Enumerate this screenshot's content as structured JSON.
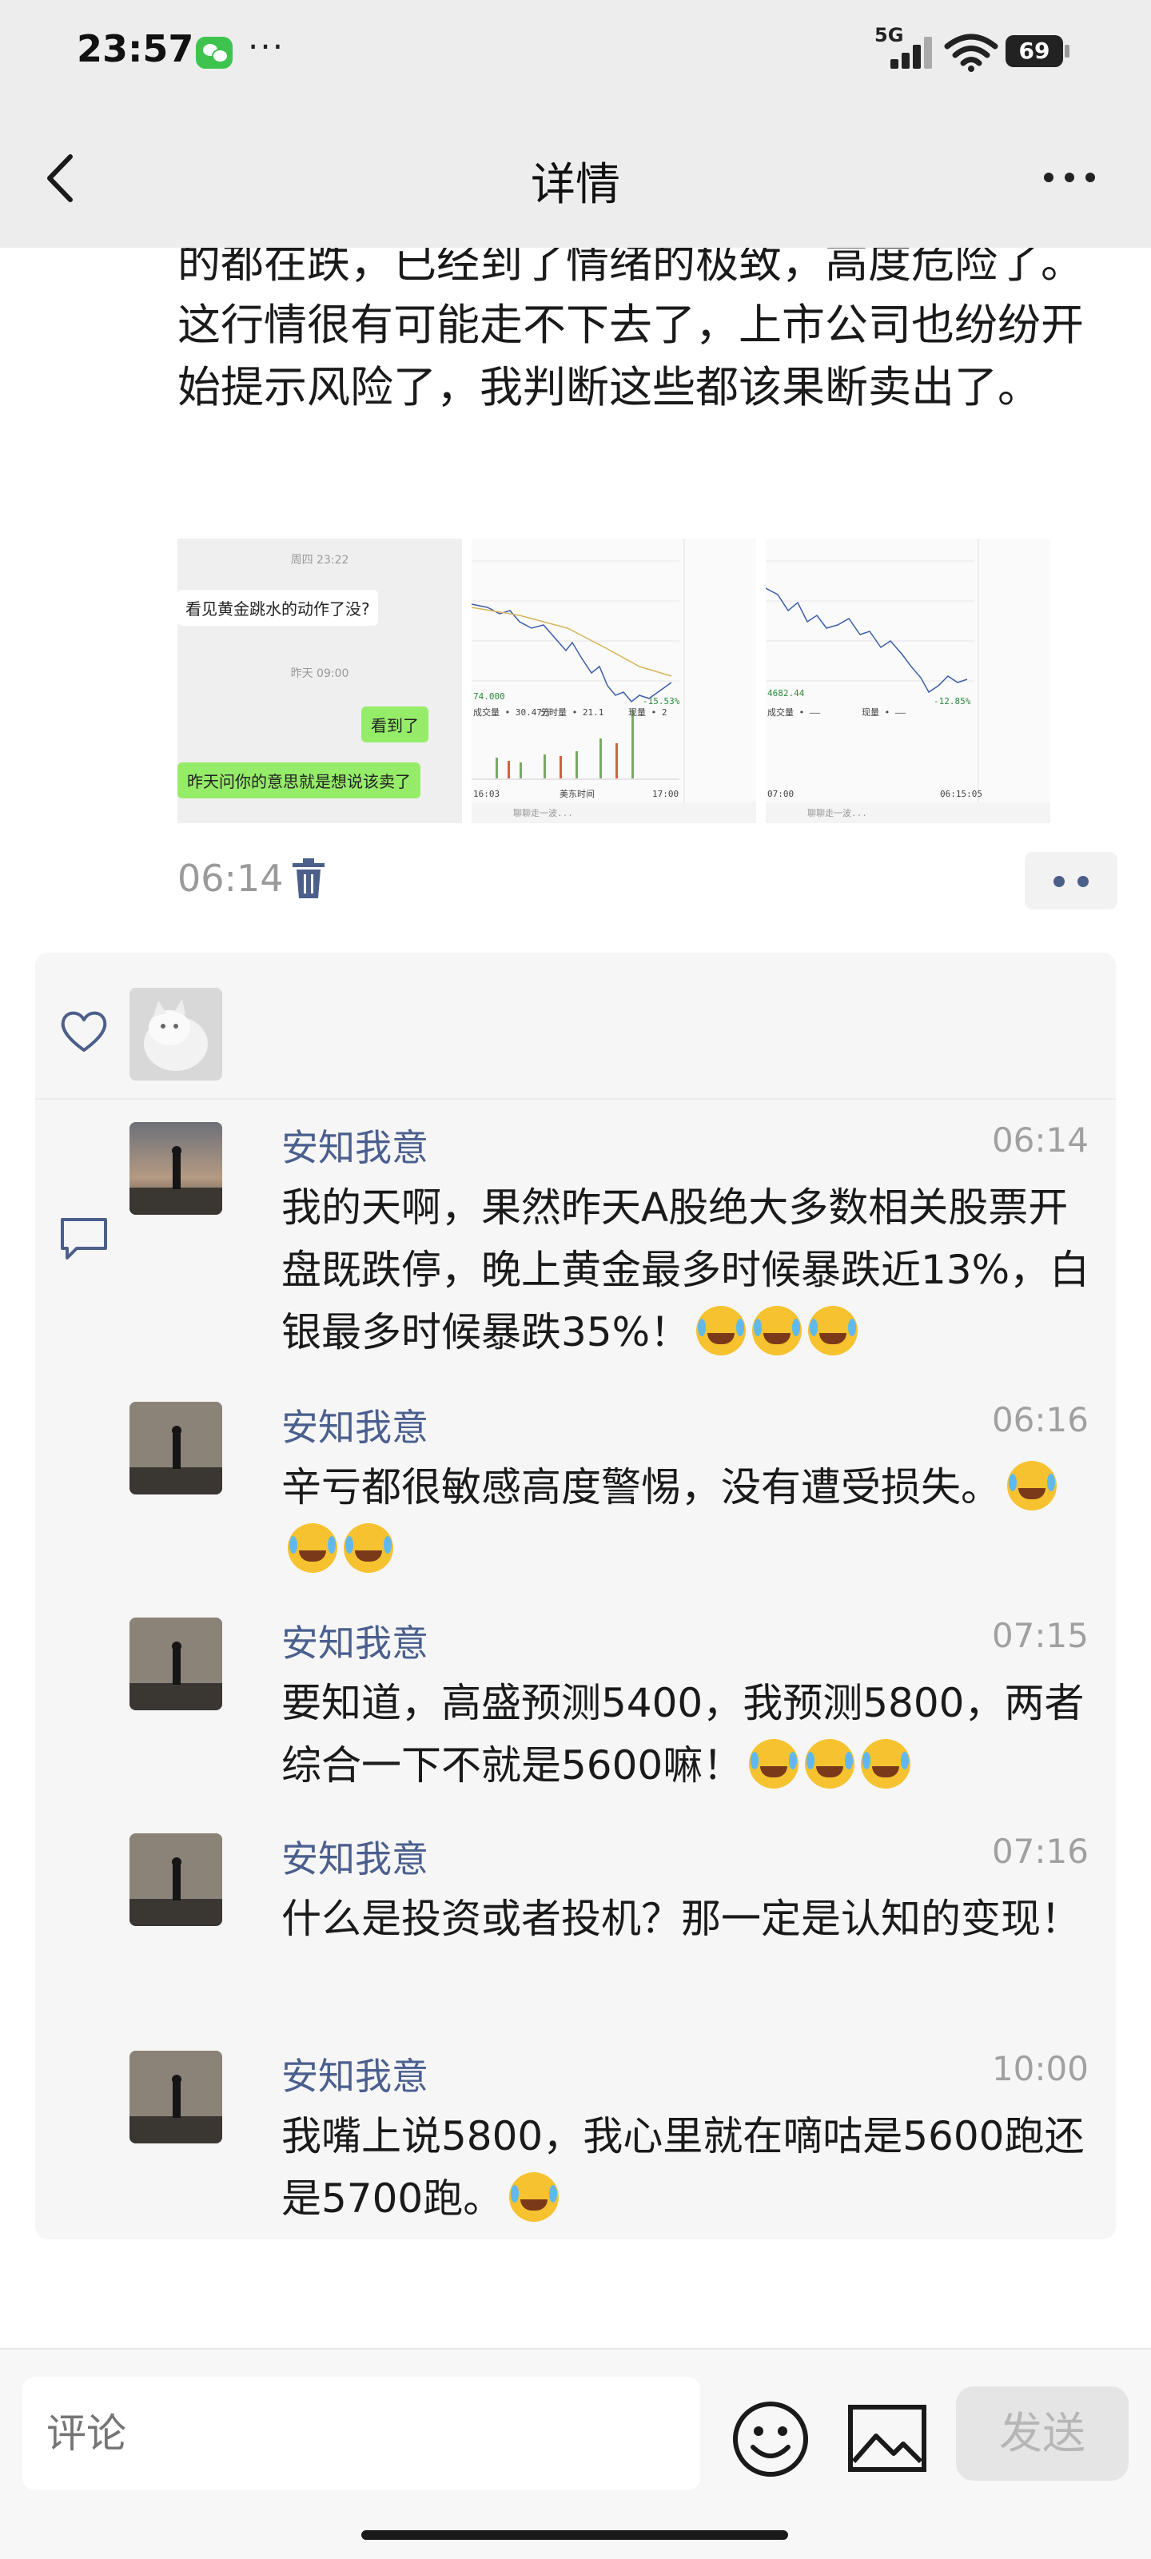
{
  "status_bar": {
    "time": "23:57",
    "more": "···",
    "network": "5G",
    "battery": "69"
  },
  "header": {
    "title": "详情",
    "back_icon": "chevron-left-icon",
    "more_icon": "more-dots-icon"
  },
  "post": {
    "text": "的都在跌，已经到了情绪的极致，高度危险了。这行情很有可能走不下去了，上市公司也纷纷开始提示风险了，我判断这些都该果断卖出了。",
    "time": "06:14",
    "images": [
      {
        "kind": "chat-screenshot",
        "top_time": "周四 23:22",
        "msg1": "看见黄金跳水的动作了没?",
        "mid_time": "昨天 09:00",
        "msg2": "看到了",
        "msg3": "昨天问你的意思就是想说该卖了"
      },
      {
        "kind": "chart-screenshot",
        "low_label": "74.000",
        "pct_label": "-15.53%",
        "vol_label": "成交量 • 30.47万",
        "vol2_label": "分时量 • 21.1",
        "vol3_label": "现量 • 2",
        "time_left": "16:03",
        "time_mid": "美东时间",
        "time_right": "17:00",
        "input_hint": "聊聊走一波..."
      },
      {
        "kind": "chart-screenshot",
        "low_label": "4682.44",
        "pct_label": "-12.85%",
        "vol_label": "成交量 • ——",
        "vol3_label": "现量 • ——",
        "time_left": "07:00",
        "time_right": "06:15:05",
        "input_hint": "聊聊走一波..."
      }
    ]
  },
  "likes": {
    "heart_icon": "heart-icon"
  },
  "comments": [
    {
      "name": "安知我意",
      "time": "06:14",
      "text": "我的天啊，果然昨天A股绝大多数相关股票开盘既跌停，晚上黄金最多时候暴跌近13%，白银最多时候暴跌35%！",
      "emoji_count": 3
    },
    {
      "name": "安知我意",
      "time": "06:16",
      "text": "辛亏都很敏感高度警惕，没有遭受损失。",
      "emoji_count": 3
    },
    {
      "name": "安知我意",
      "time": "07:15",
      "text": "要知道，高盛预测5400，我预测5800，两者综合一下不就是5600嘛！",
      "emoji_count": 3
    },
    {
      "name": "安知我意",
      "time": "07:16",
      "text": "什么是投资或者投机？那一定是认知的变现！",
      "emoji_count": 0
    },
    {
      "name": "安知我意",
      "time": "10:00",
      "text": "我嘴上说5800，我心里就在嘀咕是5600跑还是5700跑。",
      "emoji_count": 1
    }
  ],
  "input_bar": {
    "placeholder": "评论",
    "send_label": "发送"
  }
}
